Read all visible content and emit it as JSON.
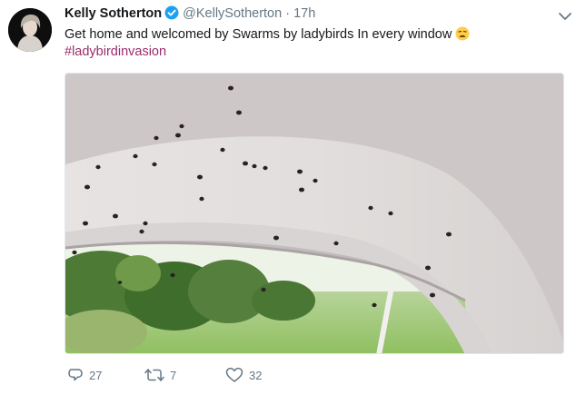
{
  "tweet": {
    "author_name": "Kelly Sotherton",
    "handle": "@KellySotherton",
    "separator": "·",
    "time": "17h",
    "text": "Get home and welcomed by Swarms by ladybirds In every window",
    "hashtag": "#ladybirdinvasion",
    "emoji": "weary-face-emoji"
  },
  "actions": {
    "replies": "27",
    "retweets": "7",
    "likes": "32"
  },
  "colors": {
    "hashtag": "#9b2c6d",
    "verified": "#1da1f2",
    "muted": "#657786"
  }
}
